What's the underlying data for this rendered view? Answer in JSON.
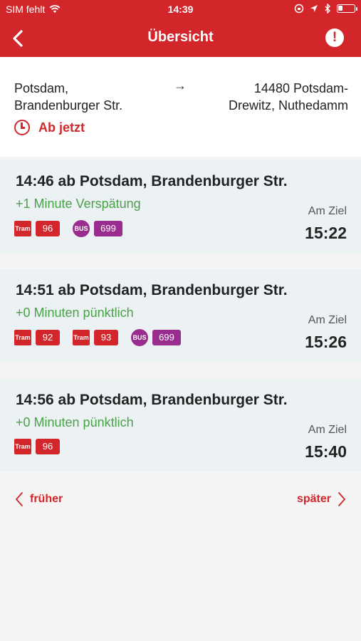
{
  "status_bar": {
    "carrier": "SIM fehlt",
    "time": "14:39",
    "icons": [
      "wifi-icon",
      "orientation-lock-icon",
      "location-icon",
      "bluetooth-icon",
      "battery-icon"
    ]
  },
  "nav": {
    "title": "Übersicht",
    "back_icon": "chevron-left-icon",
    "info_icon": "exclamation-icon"
  },
  "route": {
    "from_line1": "Potsdam,",
    "from_line2": "Brandenburger Str.",
    "arrow": "→",
    "to_line1": "14480 Potsdam-",
    "to_line2": "Drewitz, Nuthedamm",
    "time_choice": "Ab jetzt"
  },
  "journeys": [
    {
      "departure": "14:46  ab Potsdam, Brandenburger Str.",
      "delay": "+1 Minute Verspätung",
      "lines": [
        {
          "type": "Tram",
          "number": "96"
        },
        {
          "type": "BUS",
          "number": "699"
        }
      ],
      "arrival_label": "Am Ziel",
      "arrival_time": "15:22"
    },
    {
      "departure": "14:51  ab Potsdam, Brandenburger Str.",
      "delay": "+0 Minuten pünktlich",
      "lines": [
        {
          "type": "Tram",
          "number": "92"
        },
        {
          "type": "Tram",
          "number": "93"
        },
        {
          "type": "BUS",
          "number": "699"
        }
      ],
      "arrival_label": "Am Ziel",
      "arrival_time": "15:26"
    },
    {
      "departure": "14:56  ab Potsdam, Brandenburger Str.",
      "delay": "+0 Minuten pünktlich",
      "lines": [
        {
          "type": "Tram",
          "number": "96"
        }
      ],
      "arrival_label": "Am Ziel",
      "arrival_time": "15:40"
    }
  ],
  "pager": {
    "prev_label": "früher",
    "next_label": "später"
  },
  "colors": {
    "brand_red": "#d3262a",
    "bus_purple": "#9b2c8f",
    "ontime_green": "#4aa14a"
  }
}
